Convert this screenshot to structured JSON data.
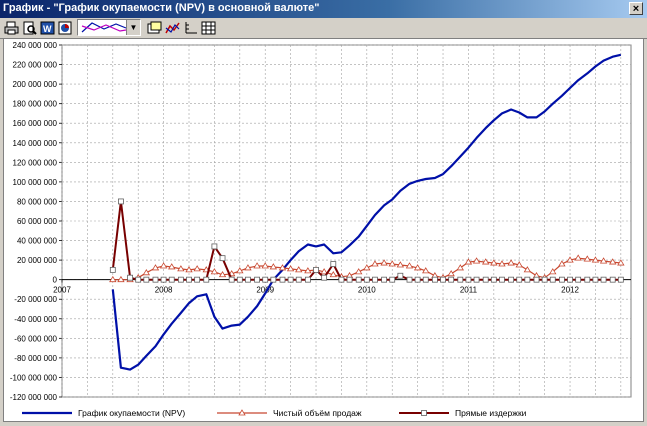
{
  "window": {
    "title": "График - \"График окупаемости (NPV) в основной валюте\"",
    "close_label": "×"
  },
  "toolbar": {
    "buttons": [
      "print-icon",
      "print-preview-icon",
      "word-export-icon",
      "chart-export-icon",
      "properties-icon",
      "chart-type-icon",
      "axis-icon",
      "table-icon"
    ]
  },
  "chart_data": {
    "type": "line",
    "title": "",
    "xlabel": "",
    "ylabel": "",
    "ylim": [
      -120000000,
      240000000
    ],
    "xlim": [
      2007.0,
      2012.6
    ],
    "y_ticks": [
      {
        "v": 240000000,
        "label": "240 000 000"
      },
      {
        "v": 220000000,
        "label": "220 000 000"
      },
      {
        "v": 200000000,
        "label": "200 000 000"
      },
      {
        "v": 180000000,
        "label": "180 000 000"
      },
      {
        "v": 160000000,
        "label": "160 000 000"
      },
      {
        "v": 140000000,
        "label": "140 000 000"
      },
      {
        "v": 120000000,
        "label": "120 000 000"
      },
      {
        "v": 100000000,
        "label": "100 000 000"
      },
      {
        "v": 80000000,
        "label": "80 000 000"
      },
      {
        "v": 60000000,
        "label": "60 000 000"
      },
      {
        "v": 40000000,
        "label": "40 000 000"
      },
      {
        "v": 20000000,
        "label": "20 000 000"
      },
      {
        "v": 0,
        "label": "0"
      },
      {
        "v": -20000000,
        "label": "-20 000 000"
      },
      {
        "v": -40000000,
        "label": "-40 000 000"
      },
      {
        "v": -60000000,
        "label": "-60 000 000"
      },
      {
        "v": -80000000,
        "label": "-80 000 000"
      },
      {
        "v": -100000000,
        "label": "-100 000 000"
      },
      {
        "v": -120000000,
        "label": "-120 000 000"
      }
    ],
    "x_ticks": [
      {
        "v": 2007.0,
        "label": "2007"
      },
      {
        "v": 2008.0,
        "label": "2008"
      },
      {
        "v": 2009.0,
        "label": "2009"
      },
      {
        "v": 2010.0,
        "label": "2010"
      },
      {
        "v": 2011.0,
        "label": "2011"
      },
      {
        "v": 2012.0,
        "label": "2012"
      }
    ],
    "grid": true,
    "legend_position": "bottom",
    "series": [
      {
        "name": "График окупаемости (NPV)",
        "color": "#0010a8",
        "marker": "none",
        "x": [
          2007.5,
          2007.58,
          2007.67,
          2007.75,
          2007.83,
          2007.92,
          2008.0,
          2008.08,
          2008.17,
          2008.25,
          2008.33,
          2008.42,
          2008.5,
          2008.58,
          2008.67,
          2008.75,
          2008.83,
          2008.92,
          2009.0,
          2009.08,
          2009.17,
          2009.25,
          2009.33,
          2009.42,
          2009.5,
          2009.58,
          2009.67,
          2009.75,
          2009.83,
          2009.92,
          2010.0,
          2010.08,
          2010.17,
          2010.25,
          2010.33,
          2010.42,
          2010.5,
          2010.58,
          2010.67,
          2010.75,
          2010.83,
          2010.92,
          2011.0,
          2011.08,
          2011.17,
          2011.25,
          2011.33,
          2011.42,
          2011.5,
          2011.58,
          2011.67,
          2011.75,
          2011.83,
          2011.92,
          2012.0,
          2012.08,
          2012.17,
          2012.25,
          2012.33,
          2012.42,
          2012.5
        ],
        "values": [
          -10000000,
          -90000000,
          -92000000,
          -87000000,
          -78000000,
          -68000000,
          -56000000,
          -45000000,
          -34000000,
          -24000000,
          -17000000,
          -15000000,
          -38000000,
          -50000000,
          -47000000,
          -46000000,
          -38000000,
          -27000000,
          -14000000,
          0,
          10000000,
          20000000,
          29000000,
          36000000,
          34000000,
          36000000,
          27000000,
          28000000,
          35000000,
          44000000,
          55000000,
          66000000,
          76000000,
          82000000,
          91000000,
          98000000,
          101000000,
          103000000,
          104000000,
          108000000,
          116000000,
          126000000,
          135000000,
          145000000,
          155000000,
          163000000,
          170000000,
          174000000,
          171000000,
          166000000,
          166000000,
          172000000,
          180000000,
          188000000,
          196000000,
          204000000,
          211000000,
          218000000,
          224000000,
          228000000,
          230000000
        ]
      },
      {
        "name": "Чистый объём продаж",
        "color": "#c84830",
        "marker": "triangle",
        "x": [
          2007.5,
          2007.58,
          2007.67,
          2007.75,
          2007.83,
          2007.92,
          2008.0,
          2008.08,
          2008.17,
          2008.25,
          2008.33,
          2008.42,
          2008.5,
          2008.58,
          2008.67,
          2008.75,
          2008.83,
          2008.92,
          2009.0,
          2009.08,
          2009.17,
          2009.25,
          2009.33,
          2009.42,
          2009.5,
          2009.58,
          2009.67,
          2009.75,
          2009.83,
          2009.92,
          2010.0,
          2010.08,
          2010.17,
          2010.25,
          2010.33,
          2010.42,
          2010.5,
          2010.58,
          2010.67,
          2010.75,
          2010.83,
          2010.92,
          2011.0,
          2011.08,
          2011.17,
          2011.25,
          2011.33,
          2011.42,
          2011.5,
          2011.58,
          2011.67,
          2011.75,
          2011.83,
          2011.92,
          2012.0,
          2012.08,
          2012.17,
          2012.25,
          2012.33,
          2012.42,
          2012.5
        ],
        "values": [
          0,
          0,
          0,
          2000000,
          7000000,
          12000000,
          14000000,
          13000000,
          11000000,
          10000000,
          11000000,
          10000000,
          8000000,
          5000000,
          6000000,
          9000000,
          12000000,
          14000000,
          14000000,
          13000000,
          12000000,
          11000000,
          10000000,
          9000000,
          10000000,
          8000000,
          5000000,
          3000000,
          4000000,
          8000000,
          12000000,
          16000000,
          17000000,
          16000000,
          15000000,
          14000000,
          12000000,
          9000000,
          4000000,
          2000000,
          6000000,
          12000000,
          18000000,
          19000000,
          18000000,
          17000000,
          16000000,
          17000000,
          15000000,
          10000000,
          4000000,
          2000000,
          8000000,
          16000000,
          20000000,
          22000000,
          21000000,
          20000000,
          19000000,
          18000000,
          17000000
        ]
      },
      {
        "name": "Прямые издержки",
        "color": "#780000",
        "marker": "square",
        "x": [
          2007.5,
          2007.58,
          2007.67,
          2007.75,
          2007.83,
          2007.92,
          2008.0,
          2008.08,
          2008.17,
          2008.25,
          2008.33,
          2008.42,
          2008.5,
          2008.58,
          2008.67,
          2008.75,
          2008.83,
          2008.92,
          2009.0,
          2009.08,
          2009.17,
          2009.25,
          2009.33,
          2009.42,
          2009.5,
          2009.58,
          2009.67,
          2009.75,
          2009.83,
          2009.92,
          2010.0,
          2010.08,
          2010.17,
          2010.25,
          2010.33,
          2010.42,
          2010.5,
          2010.58,
          2010.67,
          2010.75,
          2010.83,
          2010.92,
          2011.0,
          2011.08,
          2011.17,
          2011.25,
          2011.33,
          2011.42,
          2011.5,
          2011.58,
          2011.67,
          2011.75,
          2011.83,
          2011.92,
          2012.0,
          2012.08,
          2012.17,
          2012.25,
          2012.33,
          2012.42,
          2012.5
        ],
        "values": [
          10000000,
          80000000,
          2000000,
          0,
          0,
          0,
          0,
          0,
          0,
          0,
          0,
          0,
          34000000,
          22000000,
          0,
          0,
          0,
          0,
          0,
          0,
          0,
          0,
          0,
          0,
          10000000,
          2000000,
          16000000,
          0,
          0,
          0,
          0,
          0,
          0,
          0,
          4000000,
          0,
          0,
          0,
          0,
          0,
          0,
          0,
          0,
          0,
          0,
          0,
          0,
          0,
          0,
          0,
          0,
          0,
          0,
          0,
          0,
          0,
          0,
          0,
          0,
          0,
          0
        ]
      }
    ]
  }
}
